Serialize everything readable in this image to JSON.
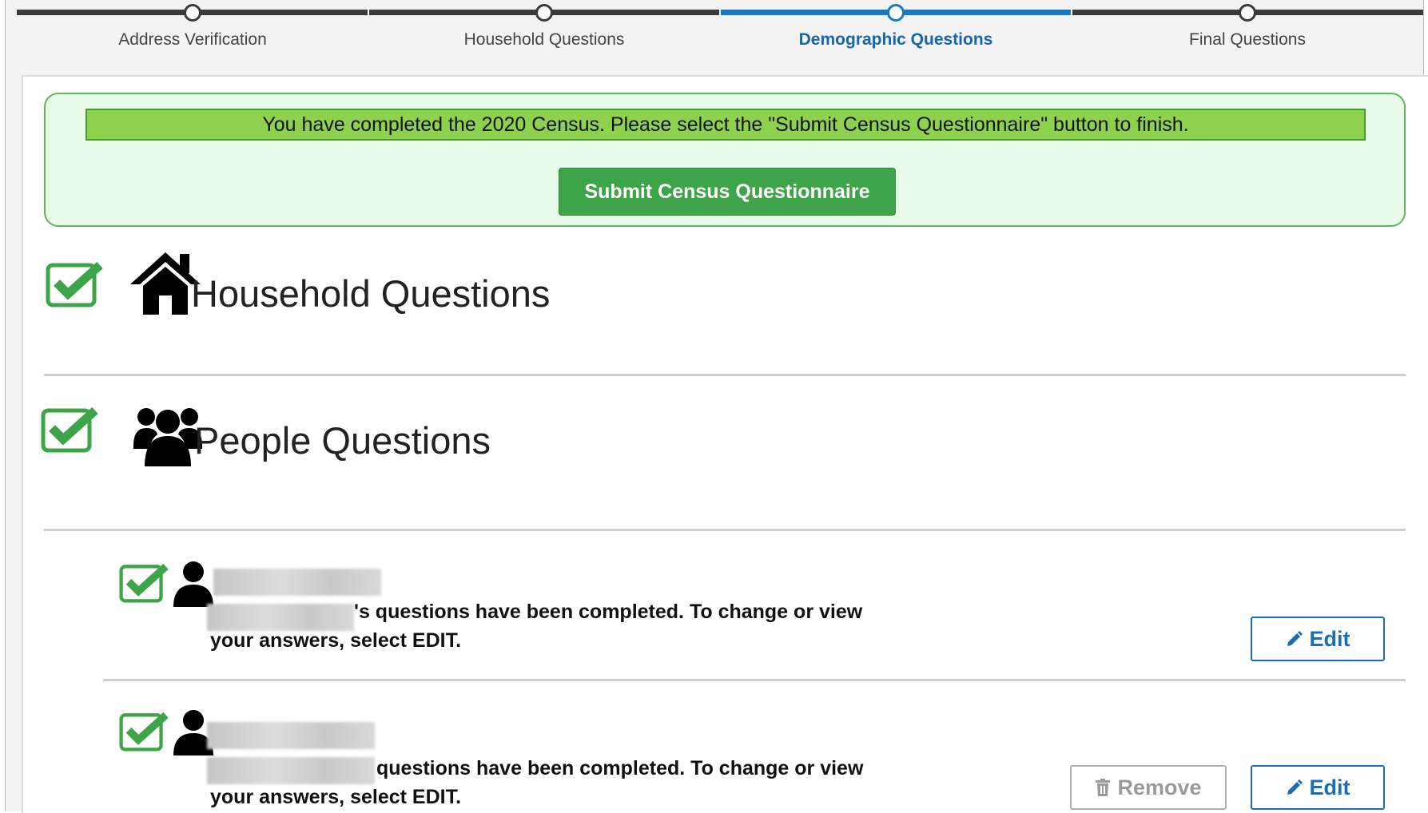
{
  "stepper": {
    "steps": [
      {
        "label": "Address Verification",
        "active": false
      },
      {
        "label": "Household Questions",
        "active": false
      },
      {
        "label": "Demographic Questions",
        "active": true
      },
      {
        "label": "Final Questions",
        "active": false
      }
    ],
    "active_color": "#1a78c2",
    "inactive_color": "#3a3a3a"
  },
  "banner": {
    "message": "You have completed the 2020 Census. Please select the \"Submit Census Questionnaire\" button to finish.",
    "submit_label": "Submit Census Questionnaire",
    "accent_color": "#3ea44a"
  },
  "sections": {
    "household": {
      "title": "Household Questions",
      "icon": "house-icon",
      "status": "completed"
    },
    "people": {
      "title": "People Questions",
      "icon": "group-icon",
      "status": "completed"
    }
  },
  "people": [
    {
      "status_text_line1": "'s questions have been completed. To change or view",
      "status_text_line2": "your answers, select EDIT.",
      "edit_label": "Edit"
    },
    {
      "status_text_line1": "questions have been completed. To change or view",
      "status_text_line2": "your answers, select EDIT.",
      "remove_label": "Remove",
      "edit_label": "Edit"
    }
  ]
}
